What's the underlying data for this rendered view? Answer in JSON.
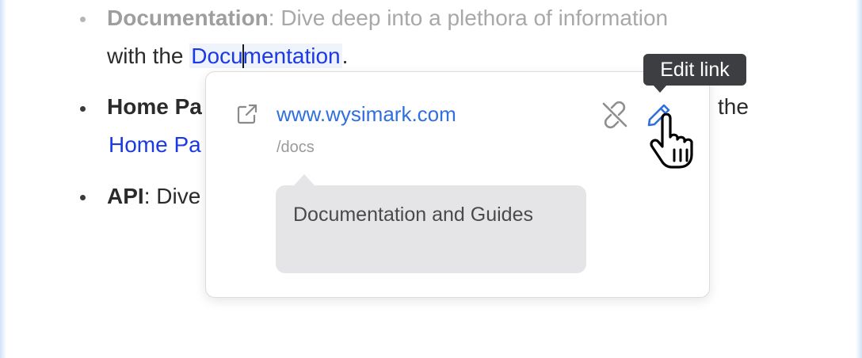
{
  "list": {
    "item1": {
      "bold": "Documentation",
      "text": ": Dive deep into a plethora of information",
      "line2_prefix": "with the ",
      "link_a": "Docu",
      "link_b": "mentation",
      "line2_suffix": "."
    },
    "item2": {
      "bold": "Home Pa",
      "tail": "the",
      "link": "Home Pa"
    },
    "item3": {
      "bold": "API",
      "text": ": Dive"
    }
  },
  "popover": {
    "url": "www.wysimark.com",
    "path": "/docs",
    "title": "Documentation and Guides"
  },
  "tooltip": {
    "text": "Edit link"
  },
  "colors": {
    "link": "#1c39e6",
    "url": "#2f6fde",
    "tooltip_bg": "#3d3e42",
    "title_bg": "#e5e5e8"
  },
  "icons": {
    "open": "external-link-icon",
    "unlink": "unlink-icon",
    "edit": "pencil-icon",
    "cursor": "hand-pointer-cursor"
  }
}
